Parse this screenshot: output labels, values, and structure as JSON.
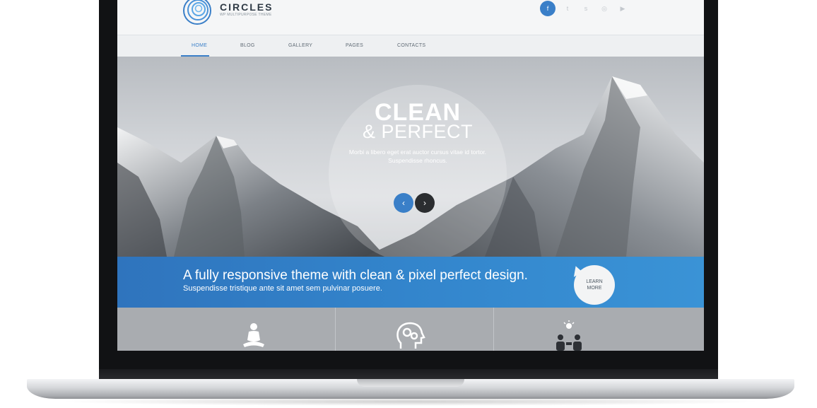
{
  "site": {
    "logo_title": "CIRCLES",
    "logo_tagline": "WP MULTIPURPOSE THEME",
    "accent_color": "#3a7fc8"
  },
  "social": [
    {
      "name": "facebook-icon",
      "glyph": "f"
    },
    {
      "name": "twitter-icon",
      "glyph": "t"
    },
    {
      "name": "skype-icon",
      "glyph": "s"
    },
    {
      "name": "dribbble-icon",
      "glyph": "◎"
    },
    {
      "name": "youtube-icon",
      "glyph": "▶"
    }
  ],
  "nav": {
    "items": [
      {
        "label": "HOME",
        "active": true
      },
      {
        "label": "BLOG",
        "active": false
      },
      {
        "label": "GALLERY",
        "active": false
      },
      {
        "label": "PAGES",
        "active": false
      },
      {
        "label": "CONTACTS",
        "active": false
      }
    ]
  },
  "hero": {
    "title_line1": "CLEAN",
    "title_line2": "& PERFECT",
    "text": "Morbi a libero eget erat auctor cursus vitae id tortor. Suspendisse rhoncus.",
    "prev_glyph": "‹",
    "next_glyph": "›"
  },
  "banner": {
    "title": "A fully responsive theme with clean & pixel perfect design.",
    "subtitle": "Suspendisse tristique ante sit amet sem pulvinar posuere.",
    "button_line1": "LEARN",
    "button_line2": "MORE"
  },
  "features": [
    {
      "icon": "meditation-icon"
    },
    {
      "icon": "head-gears-icon"
    },
    {
      "icon": "team-idea-icon"
    }
  ]
}
